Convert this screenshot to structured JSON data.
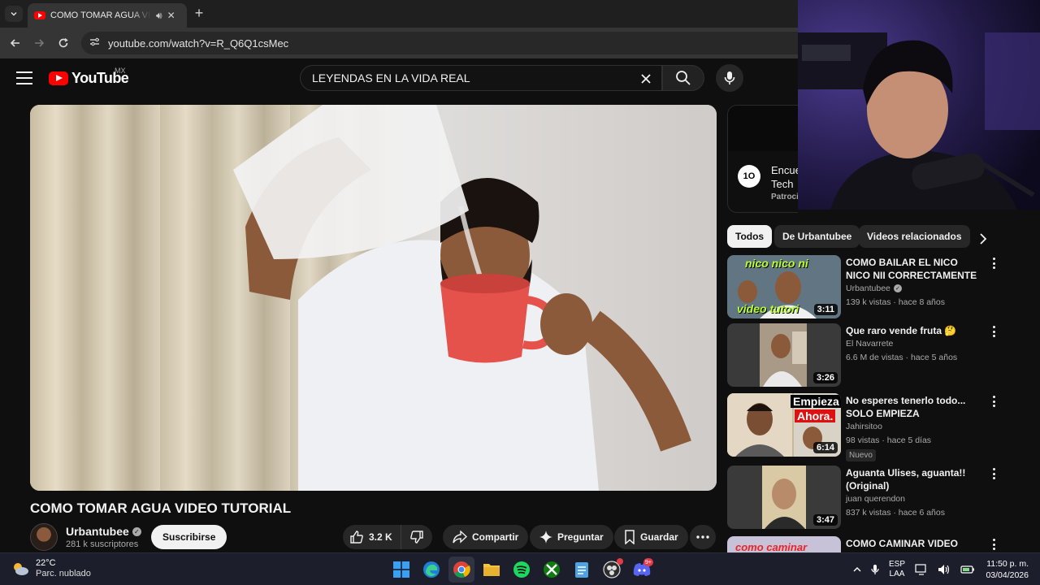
{
  "browser": {
    "tab_title": "COMO TOMAR AGUA VIDEO TUTORIAL - YouTube",
    "url": "youtube.com/watch?v=R_Q6Q1csMec"
  },
  "youtube": {
    "logo_text": "YouTube",
    "region": "MX",
    "search_query": "LEYENDAS EN LA VIDA REAL"
  },
  "video": {
    "title": "COMO TOMAR AGUA VIDEO TUTORIAL",
    "channel": "Urbantubee",
    "subscribers": "281 k suscriptores",
    "subscribe_label": "Suscribirse",
    "likes": "3.2 K",
    "share_label": "Compartir",
    "ask_label": "Preguntar",
    "save_label": "Guardar"
  },
  "ad": {
    "logo_text": "1O",
    "title_line1": "Encue",
    "title_line2": "Tech",
    "sponsored": "Patrocinado"
  },
  "chips": [
    "Todos",
    "De Urbantubee",
    "Videos relacionados"
  ],
  "recommendations": [
    {
      "title": "COMO BAILAR EL NICO NICO NII CORRECTAMENTE VIDEO TUTORIAL",
      "channel": "Urbantubee",
      "verified": true,
      "meta": "139 k vistas · hace 8 años",
      "duration": "3:11",
      "thumb_top_text": "nico nico ni",
      "thumb_bottom_text": "video tutori",
      "badge": ""
    },
    {
      "title": "Que raro vende fruta 🤔",
      "channel": "El Navarrete",
      "verified": false,
      "meta": "6.6 M de vistas · hace 5 años",
      "duration": "3:26",
      "badge": ""
    },
    {
      "title": "No esperes tenerlo todo... SOLO EMPIEZA",
      "channel": "Jahirsitoo",
      "verified": false,
      "meta": "98 vistas · hace 5 días",
      "duration": "6:14",
      "thumb_top_text": "Empieza",
      "thumb_bottom_text": "Ahora.",
      "badge": "Nuevo"
    },
    {
      "title": "Aguanta Ulises, aguanta!! (Original)",
      "channel": "juan querendon",
      "verified": false,
      "meta": "837 k vistas · hace 6 años",
      "duration": "3:47",
      "badge": ""
    },
    {
      "title": "COMO CAMINAR VIDEO",
      "channel": "",
      "verified": false,
      "meta": "",
      "duration": "",
      "thumb_top_text": "como caminar",
      "badge": ""
    }
  ],
  "taskbar": {
    "temperature": "22°C",
    "condition": "Parc. nublado",
    "discord_badge": "9+",
    "lang_line1": "ESP",
    "lang_line2": "LAA",
    "time": "11:50 p. m.",
    "date": "03/04/2026"
  },
  "colors": {
    "youtube_red": "#ff0000",
    "background": "#0f0f0f",
    "chip_bg": "#272727"
  }
}
